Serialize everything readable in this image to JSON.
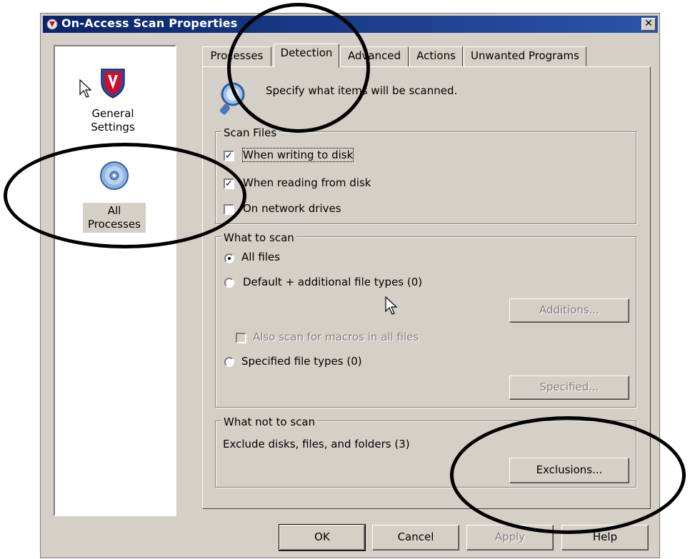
{
  "window": {
    "title": "On-Access Scan Properties",
    "close_glyph": "✕"
  },
  "nav": {
    "items": [
      {
        "label_line1": "General",
        "label_line2": "Settings",
        "icon": "mcafee-shield-icon"
      },
      {
        "label_line1": "All",
        "label_line2": "Processes",
        "icon": "disc-icon"
      }
    ]
  },
  "tabs": [
    "Processes",
    "Detection",
    "Advanced",
    "Actions",
    "Unwanted Programs"
  ],
  "active_tab": "Detection",
  "detection": {
    "header_text": "Specify what items will be scanned.",
    "scan_files": {
      "legend": "Scan Files",
      "options": [
        {
          "label": "When writing to disk",
          "checked": true
        },
        {
          "label": "When reading from disk",
          "checked": true
        },
        {
          "label": "On network drives",
          "checked": false
        }
      ]
    },
    "what_to_scan": {
      "legend": "What to scan",
      "all_files": "All files",
      "default_additional": "Default + additional file types (0)",
      "additions_button": "Additions...",
      "macros": "Also scan for macros in all files",
      "specified_types": "Specified file types (0)",
      "specified_button": "Specified...",
      "selected": "All files"
    },
    "what_not_to_scan": {
      "legend": "What not to scan",
      "text": "Exclude disks, files, and folders (3)",
      "exclusions_button": "Exclusions..."
    }
  },
  "footer": {
    "ok": "OK",
    "cancel": "Cancel",
    "apply": "Apply",
    "help": "Help"
  },
  "colors": {
    "title_bar": "#0a246a",
    "dialog_face": "#d4d0c8",
    "shield_red": "#c8102e"
  }
}
